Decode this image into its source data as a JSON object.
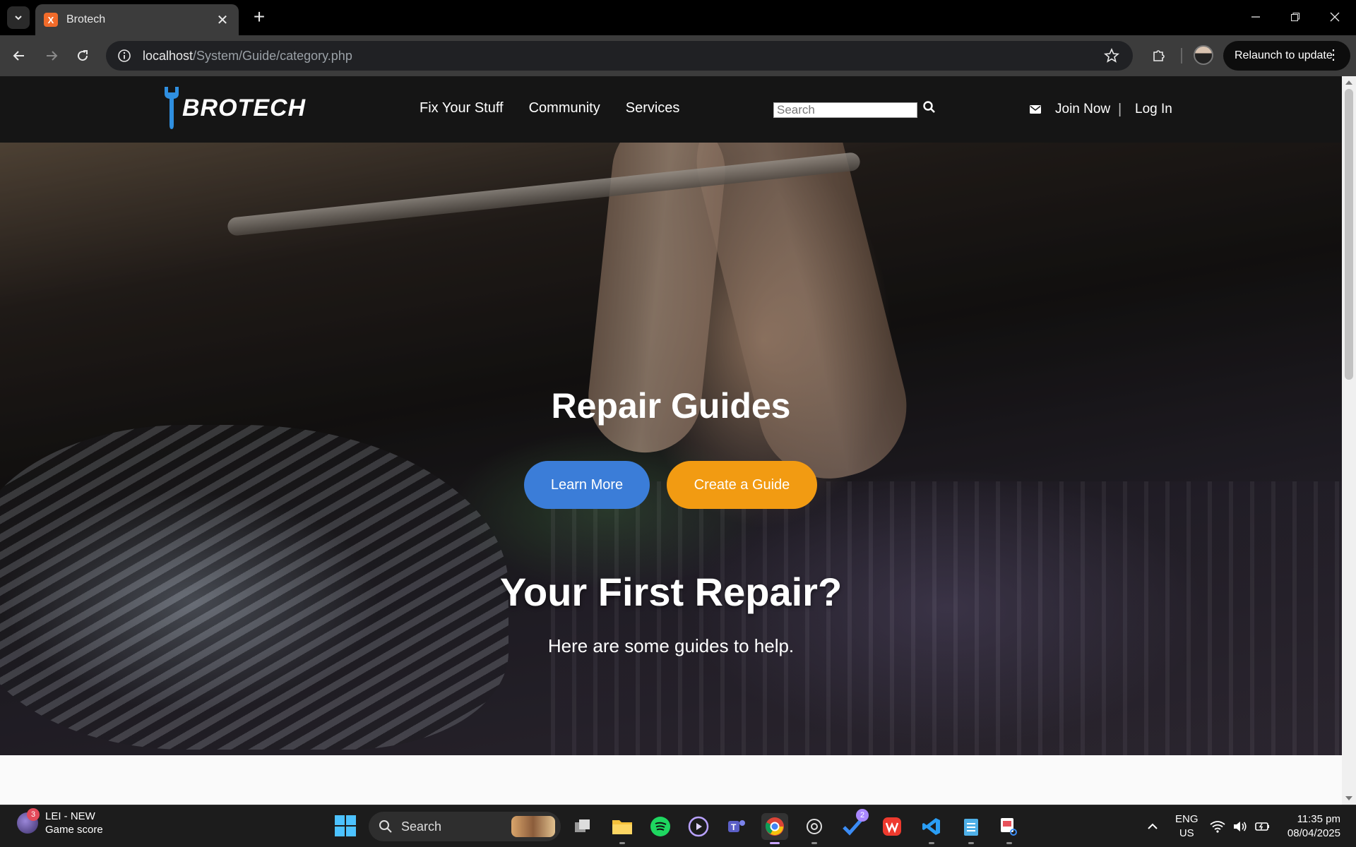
{
  "browser": {
    "tab_title": "Brotech",
    "tab_favicon_text": "X",
    "url_host": "localhost",
    "url_path": "/System/Guide/category.php",
    "relaunch_label": "Relaunch to update"
  },
  "site": {
    "logo_text": "BROTECH",
    "nav": [
      {
        "label": "Fix Your Stuff"
      },
      {
        "label": "Community"
      },
      {
        "label": "Services"
      }
    ],
    "search_placeholder": "Search",
    "join_label": "Join Now",
    "divider": "|",
    "login_label": "Log In"
  },
  "hero": {
    "title": "Repair Guides",
    "learn_more": "Learn More",
    "create_guide": "Create a Guide",
    "subtitle": "Your First Repair?",
    "text": "Here are some guides to help."
  },
  "taskbar": {
    "widget_badge": "3",
    "widget_title": "LEI - NEW",
    "widget_subtitle": "Game score",
    "search_label": "Search",
    "todo_badge": "2",
    "lang_line1": "ENG",
    "lang_line2": "US",
    "time": "11:35 pm",
    "date": "08/04/2025"
  },
  "colors": {
    "learn_more": "#3b7dd8",
    "create_guide": "#f29b12",
    "logo_accent": "#2f8fe0",
    "site_nav_bg": "#151515"
  }
}
